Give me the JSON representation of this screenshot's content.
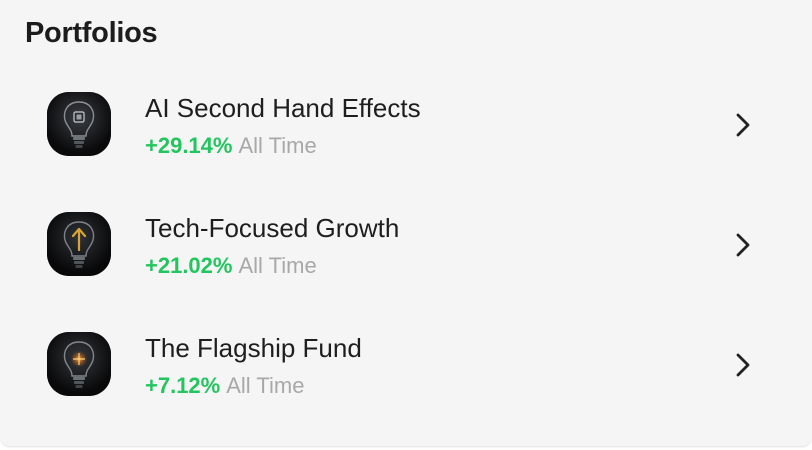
{
  "section": {
    "title": "Portfolios"
  },
  "colors": {
    "gain": "#22c55e",
    "muted": "#a8a8a8",
    "title": "#1c1c1c"
  },
  "portfolios": [
    {
      "name": "AI Second Hand Effects",
      "change": "+29.14%",
      "period": "All Time",
      "icon": "lightbulb-chip-icon"
    },
    {
      "name": "Tech-Focused Growth",
      "change": "+21.02%",
      "period": "All Time",
      "icon": "lightbulb-arrow-icon"
    },
    {
      "name": "The Flagship Fund",
      "change": "+7.12%",
      "period": "All Time",
      "icon": "lightbulb-glow-icon"
    }
  ]
}
